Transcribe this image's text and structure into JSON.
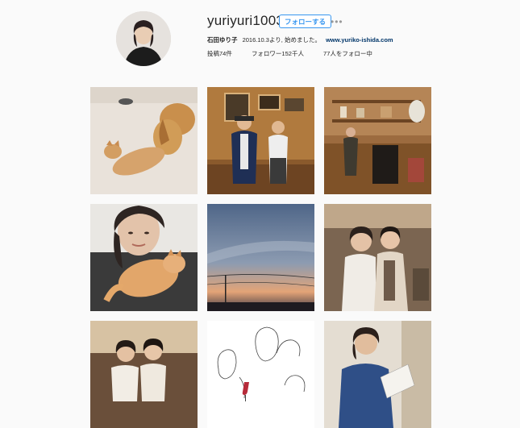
{
  "profile": {
    "username": "yuriyuri1003",
    "follow_label": "フォローする",
    "more_label": "•••",
    "full_name": "石田ゆり子",
    "bio_text": "2016.10.3より, 始めました。",
    "website": "www.yuriko-ishida.com",
    "posts_label": "投稿74件",
    "followers_label": "フォロワー152千人",
    "following_label": "77人をフォロー中"
  },
  "posts": [
    {
      "id": "post-1",
      "subject": "cat-and-dog"
    },
    {
      "id": "post-2",
      "subject": "two-people-in-room"
    },
    {
      "id": "post-3",
      "subject": "woman-in-cafe"
    },
    {
      "id": "post-4",
      "subject": "woman-with-cat"
    },
    {
      "id": "post-5",
      "subject": "sunset-sky"
    },
    {
      "id": "post-6",
      "subject": "two-women-smiling"
    },
    {
      "id": "post-7",
      "subject": "two-women-indoors"
    },
    {
      "id": "post-8",
      "subject": "line-drawing"
    },
    {
      "id": "post-9",
      "subject": "woman-reading"
    }
  ]
}
